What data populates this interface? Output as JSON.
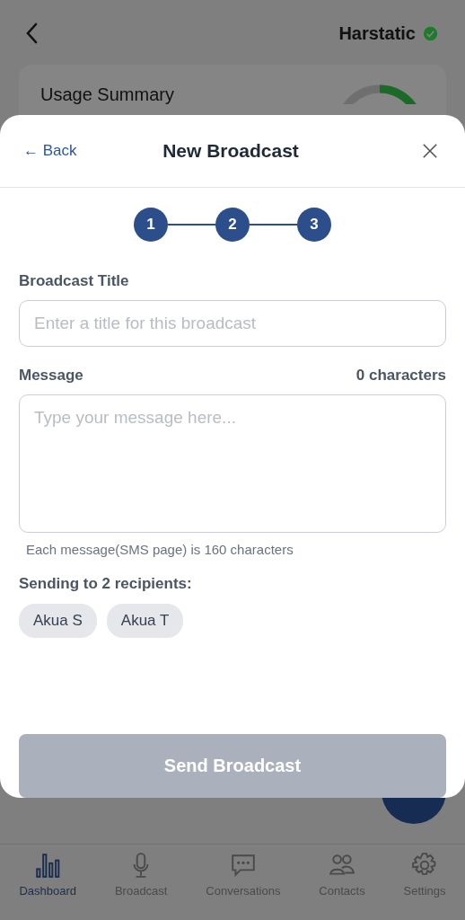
{
  "header": {
    "account": "Harstatic",
    "verified": true
  },
  "usage_card": {
    "title": "Usage Summary"
  },
  "modal": {
    "back": "← Back",
    "title": "New Broadcast",
    "steps": [
      {
        "label": "1",
        "done": true
      },
      {
        "label": "2",
        "done": true
      },
      {
        "label": "3",
        "done": true
      }
    ],
    "title_field": {
      "label": "Broadcast Title",
      "placeholder": "Enter a title for this broadcast"
    },
    "message_field": {
      "label": "Message",
      "counter": "0 characters",
      "placeholder": "Type your message here...",
      "hint": "Each message(SMS page) is 160 characters"
    },
    "recipients": {
      "label": "Sending to 2 recipients:",
      "chips": [
        "Akua S",
        "Akua T"
      ]
    },
    "send_button": {
      "label": "Send Broadcast",
      "disabled": true
    }
  },
  "tabs": [
    {
      "label": "Dashboard",
      "selected": true
    },
    {
      "label": "Broadcast",
      "selected": false
    },
    {
      "label": "Conversations",
      "selected": false
    },
    {
      "label": "Contacts",
      "selected": false
    },
    {
      "label": "Settings",
      "selected": false
    }
  ]
}
